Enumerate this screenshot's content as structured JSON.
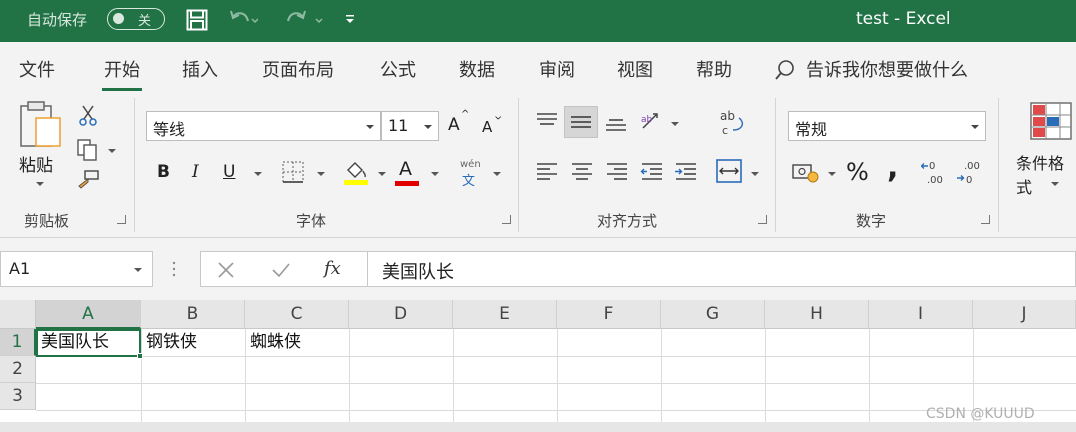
{
  "titlebar": {
    "autosave_label": "自动保存",
    "autosave_state": "关",
    "title": "test  -  Excel",
    "accent": "#217346"
  },
  "tabs": [
    {
      "label": "文件"
    },
    {
      "label": "开始",
      "active": true
    },
    {
      "label": "插入"
    },
    {
      "label": "页面布局"
    },
    {
      "label": "公式"
    },
    {
      "label": "数据"
    },
    {
      "label": "审阅"
    },
    {
      "label": "视图"
    },
    {
      "label": "帮助"
    }
  ],
  "tell_me": "告诉我你想要做什么",
  "clipboard": {
    "paste_label": "粘贴",
    "group_label": "剪贴板"
  },
  "font": {
    "name": "等线",
    "size": "11",
    "grow_label": "A",
    "shrink_label": "A",
    "bold": "B",
    "italic": "I",
    "underline": "U",
    "font_color_glyph": "A",
    "phonetic_top": "wén",
    "phonetic_bottom": "文",
    "group_label": "字体"
  },
  "alignment": {
    "group_label": "对齐方式"
  },
  "number": {
    "format": "常规",
    "percent": "%",
    "comma": ",",
    "group_label": "数字"
  },
  "styles": {
    "conditional_label": "条件格式"
  },
  "formula_bar": {
    "name_box": "A1",
    "fx": "fx",
    "content": "美国队长"
  },
  "grid": {
    "columns": [
      "A",
      "B",
      "C",
      "D",
      "E",
      "F",
      "G",
      "H",
      "I",
      "J"
    ],
    "rows": [
      "1",
      "2",
      "3"
    ],
    "cells": {
      "A1": "美国队长",
      "B1": "钢铁侠",
      "C1": "蜘蛛侠"
    }
  },
  "watermark": "CSDN @KUUUD"
}
